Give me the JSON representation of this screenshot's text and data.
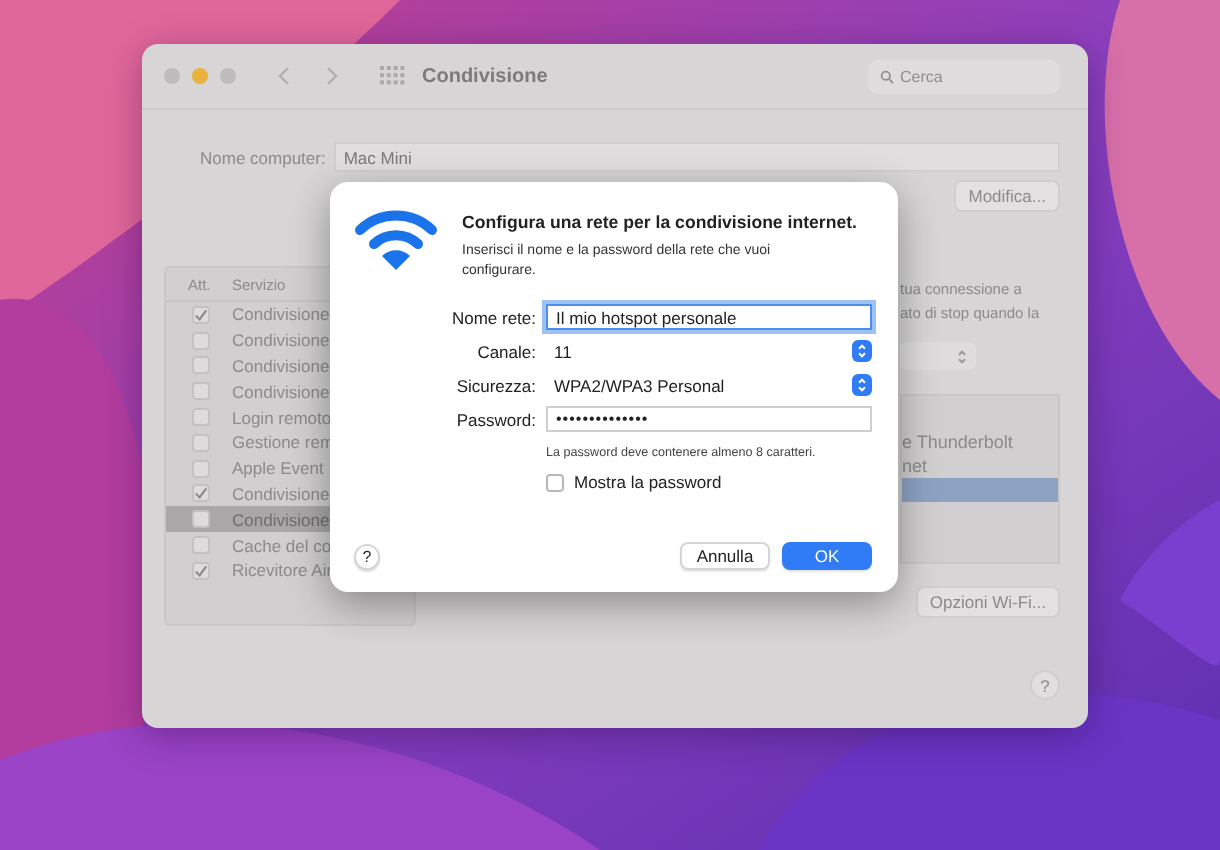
{
  "window": {
    "title": "Condivisione",
    "search": {
      "placeholder": "Cerca"
    }
  },
  "computer_name": {
    "label": "Nome computer:",
    "value": "Mac Mini",
    "button": "Modifica..."
  },
  "services": {
    "columns": [
      "Att.",
      "Servizio"
    ],
    "rows": [
      {
        "name": "Condivisione",
        "checked": true,
        "selected": false
      },
      {
        "name": "Condivisione",
        "checked": false,
        "selected": false
      },
      {
        "name": "Condivisione",
        "checked": false,
        "selected": false
      },
      {
        "name": "Condivisione",
        "checked": false,
        "selected": false
      },
      {
        "name": "Login remoto",
        "checked": false,
        "selected": false
      },
      {
        "name": "Gestione rem",
        "checked": false,
        "selected": false
      },
      {
        "name": "Apple Event",
        "checked": false,
        "selected": false
      },
      {
        "name": "Condivisione",
        "checked": true,
        "selected": false
      },
      {
        "name": "Condivisione",
        "checked": false,
        "selected": true
      },
      {
        "name": "Cache del co",
        "checked": false,
        "selected": false
      },
      {
        "name": "Ricevitore Air",
        "checked": true,
        "selected": false
      }
    ]
  },
  "side_text": [
    "tua connessione a",
    "ato di stop quando la"
  ],
  "interfaces": [
    {
      "name": "e Thunderbolt",
      "selected": false
    },
    {
      "name": "net",
      "selected": false
    },
    {
      "selected": true
    }
  ],
  "wifi_options_button": "Opzioni Wi-Fi...",
  "help": "?",
  "dialog": {
    "title": "Configura una rete per la condivisione internet.",
    "message": "Inserisci il nome e la password della rete che vuoi configurare.",
    "fields": [
      {
        "kind": "text",
        "label": "Nome rete:",
        "value": "Il mio hotspot personale",
        "focused": true
      },
      {
        "kind": "select",
        "label": "Canale:",
        "value": "11"
      },
      {
        "kind": "select",
        "label": "Sicurezza:",
        "value": "WPA2/WPA3 Personal"
      },
      {
        "kind": "password",
        "label": "Password:",
        "value": "••••••••••••••",
        "focused": false
      }
    ],
    "hint": "La password deve contenere almeno 8 caratteri.",
    "show_password": {
      "label": "Mostra la password",
      "checked": false
    },
    "help": "?",
    "buttons": [
      {
        "label": "Annulla",
        "default": false
      },
      {
        "label": "OK",
        "default": true
      }
    ]
  }
}
